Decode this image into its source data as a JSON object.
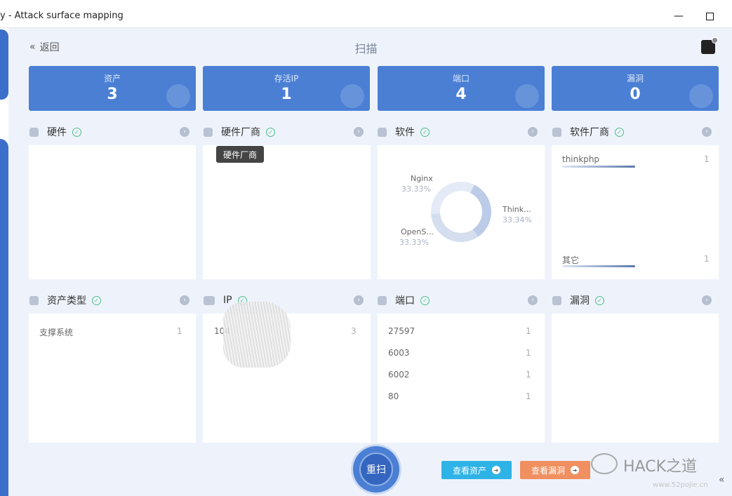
{
  "window": {
    "title": "y - Attack surface mapping"
  },
  "header": {
    "back_label": "返回",
    "back_icon": "double-chevron-left-icon",
    "title": "扫描"
  },
  "stats": [
    {
      "label": "资产",
      "value": "3",
      "icon": "layers-icon"
    },
    {
      "label": "存活IP",
      "value": "1",
      "icon": "ip-icon"
    },
    {
      "label": "端口",
      "value": "4",
      "icon": "port-icon"
    },
    {
      "label": "漏洞",
      "value": "0",
      "icon": "bug-icon"
    }
  ],
  "panels": {
    "hardware": {
      "title": "硬件"
    },
    "hardware_vendor": {
      "title": "硬件厂商",
      "tooltip": "硬件厂商"
    },
    "software": {
      "title": "软件",
      "chart_data": {
        "type": "pie",
        "slices": [
          {
            "label": "Nginx",
            "value": 33.33,
            "pct": "33.33%"
          },
          {
            "label": "Think...",
            "value": 33.34,
            "pct": "33.34%"
          },
          {
            "label": "OpenS...",
            "value": 33.33,
            "pct": "33.33%"
          }
        ],
        "colors": [
          "#bccbe8",
          "#d4deef",
          "#e4ebf6"
        ]
      }
    },
    "software_vendor": {
      "title": "软件厂商",
      "items": [
        {
          "name": "thinkphp",
          "count": "1"
        },
        {
          "name": "其它",
          "count": "1"
        }
      ]
    },
    "asset_type": {
      "title": "资产类型",
      "items": [
        {
          "name": "支撑系统",
          "count": "1"
        }
      ]
    },
    "ip": {
      "title": "IP",
      "items": [
        {
          "name": "104",
          "count": "3"
        }
      ]
    },
    "port": {
      "title": "端口",
      "items": [
        {
          "name": "27597",
          "count": "1"
        },
        {
          "name": "6003",
          "count": "1"
        },
        {
          "name": "6002",
          "count": "1"
        },
        {
          "name": "80",
          "count": "1"
        }
      ]
    },
    "vuln": {
      "title": "漏洞"
    }
  },
  "footer": {
    "rescan_label": "重扫",
    "view_assets_label": "查看资产",
    "view_vulns_label": "查看漏洞",
    "view_assets_color": "#2fb3e6",
    "view_vulns_color": "#f08f5f"
  },
  "watermark": {
    "text": "HACK之道",
    "url": "www.52pojie.cn"
  },
  "colors": {
    "accent": "#4a7fd4",
    "ok": "#4cbf87",
    "background": "#eef3fb"
  }
}
